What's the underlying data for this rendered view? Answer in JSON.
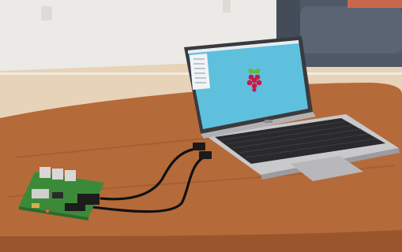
{
  "photo": {
    "subject": "laptop-connected-to-single-board-computer",
    "colors": {
      "wall": "#eceae6",
      "floor": "#e8d6bc",
      "table": "#b56a3a",
      "table_dark": "#8a4a24",
      "laptop_body": "#c9c9cb",
      "keyboard": "#2a2a2c",
      "screen_bg": "#5fc0dd",
      "logo_red": "#c51a4a",
      "logo_green": "#66b83a",
      "board_green": "#3b8a3a",
      "cable": "#111111",
      "sofa": "#4f5866"
    },
    "icons": {
      "screen_logo": "raspberry-logo-icon"
    }
  }
}
